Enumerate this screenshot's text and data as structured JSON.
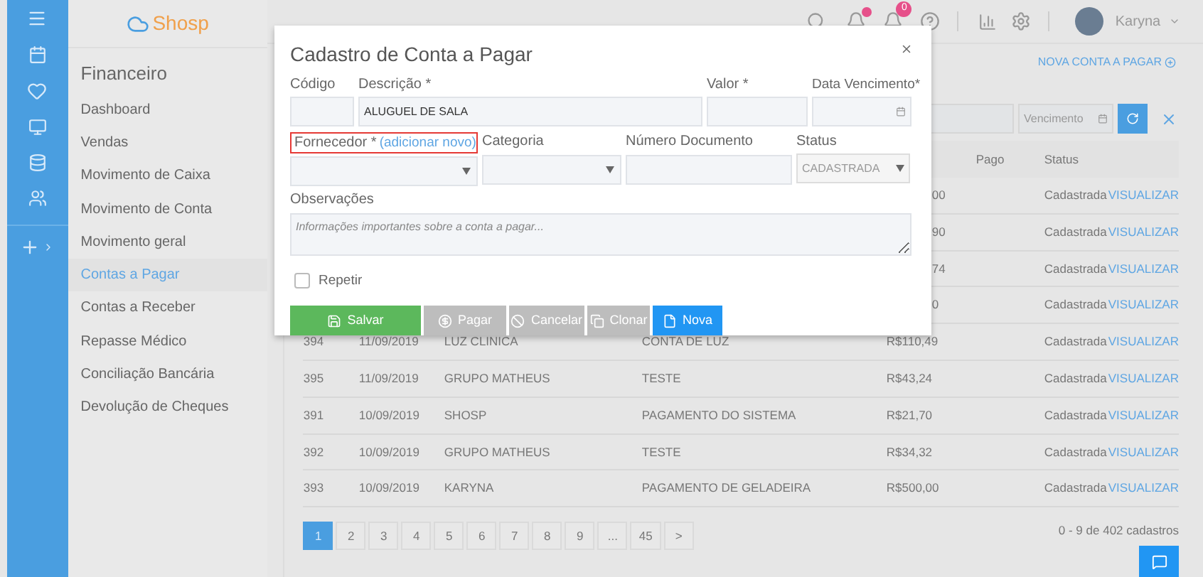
{
  "sidebar": {
    "logo": "Shosp",
    "heading": "Financeiro",
    "items": [
      {
        "label": "Dashboard",
        "selected": false
      },
      {
        "label": "Vendas",
        "selected": false
      },
      {
        "label": "Movimento de Caixa",
        "selected": false
      },
      {
        "label": "Movimento de Conta",
        "selected": false
      },
      {
        "label": "Movimento geral",
        "selected": false
      },
      {
        "label": "Contas a Pagar",
        "selected": true
      },
      {
        "label": "Contas a Receber",
        "selected": false
      },
      {
        "label": "Repasse Médico",
        "selected": false
      },
      {
        "label": "Conciliação Bancária",
        "selected": false
      },
      {
        "label": "Devolução de Cheques",
        "selected": false
      }
    ]
  },
  "topbar": {
    "notification_badge": "0",
    "user": "Karyna"
  },
  "page": {
    "new_button": "NOVA CONTA A PAGAR",
    "date_filter": {
      "placeholder": "Vencimento"
    }
  },
  "table": {
    "columns": [
      "Pago",
      "Status"
    ],
    "rows": [
      {
        "amount": "00",
        "status": "Cadastrada",
        "action": "VISUALIZAR"
      },
      {
        "amount": "90",
        "status": "Cadastrada",
        "action": "VISUALIZAR"
      },
      {
        "amount": "74",
        "status": "Cadastrada",
        "action": "VISUALIZAR"
      },
      {
        "amount": "0",
        "status": "Cadastrada",
        "action": "VISUALIZAR"
      },
      {
        "id": "394",
        "date": "11/09/2019",
        "supplier": "LUZ CLINICA",
        "description": "CONTA DE LUZ",
        "amount": "R$110,49",
        "status": "Cadastrada",
        "action": "VISUALIZAR"
      },
      {
        "id": "395",
        "date": "11/09/2019",
        "supplier": "GRUPO MATHEUS",
        "description": "TESTE",
        "amount": "R$43,24",
        "status": "Cadastrada",
        "action": "VISUALIZAR"
      },
      {
        "id": "391",
        "date": "10/09/2019",
        "supplier": "SHOSP",
        "description": "PAGAMENTO DO SISTEMA",
        "amount": "R$21,70",
        "status": "Cadastrada",
        "action": "VISUALIZAR"
      },
      {
        "id": "392",
        "date": "10/09/2019",
        "supplier": "GRUPO MATHEUS",
        "description": "TESTE",
        "amount": "R$34,32",
        "status": "Cadastrada",
        "action": "VISUALIZAR"
      },
      {
        "id": "393",
        "date": "10/09/2019",
        "supplier": "KARYNA",
        "description": "PAGAMENTO DE GELADEIRA",
        "amount": "R$500,00",
        "status": "Cadastrada",
        "action": "VISUALIZAR"
      }
    ]
  },
  "pagination": {
    "pages": [
      {
        "label": "1",
        "selected": true
      },
      {
        "label": "2",
        "selected": false
      },
      {
        "label": "3",
        "selected": false
      },
      {
        "label": "4",
        "selected": false
      },
      {
        "label": "5",
        "selected": false
      },
      {
        "label": "6",
        "selected": false
      },
      {
        "label": "7",
        "selected": false
      },
      {
        "label": "8",
        "selected": false
      },
      {
        "label": "9",
        "selected": false
      },
      {
        "label": "...",
        "selected": false
      },
      {
        "label": "45",
        "selected": false
      },
      {
        "label": ">",
        "selected": false
      }
    ],
    "summary": "0 - 9 de 402 cadastros"
  },
  "modal": {
    "title": "Cadastro de Conta a Pagar",
    "codigo": {
      "label": "Código"
    },
    "descricao": {
      "label": "Descrição *",
      "value": "ALUGUEL DE SALA"
    },
    "valor": {
      "label": "Valor *"
    },
    "vencimento": {
      "label": "Data Vencimento*"
    },
    "fornecedor": {
      "label": "Fornecedor *",
      "link": "(adicionar novo)",
      "highlighted": true
    },
    "categoria": {
      "label": "Categoria"
    },
    "documento": {
      "label": "Número Documento"
    },
    "status": {
      "label": "Status",
      "value": "CADASTRADA"
    },
    "observacoes": {
      "label": "Observações",
      "placeholder": "Informações importantes sobre a conta a pagar..."
    },
    "repetir": {
      "label": "Repetir",
      "checked": false
    },
    "buttons": [
      {
        "kind": "save",
        "label": "Salvar"
      },
      {
        "kind": "pay",
        "label": "Pagar"
      },
      {
        "kind": "cancel",
        "label": "Cancelar"
      },
      {
        "kind": "clone",
        "label": "Clonar"
      },
      {
        "kind": "new",
        "label": "Nova"
      }
    ]
  }
}
